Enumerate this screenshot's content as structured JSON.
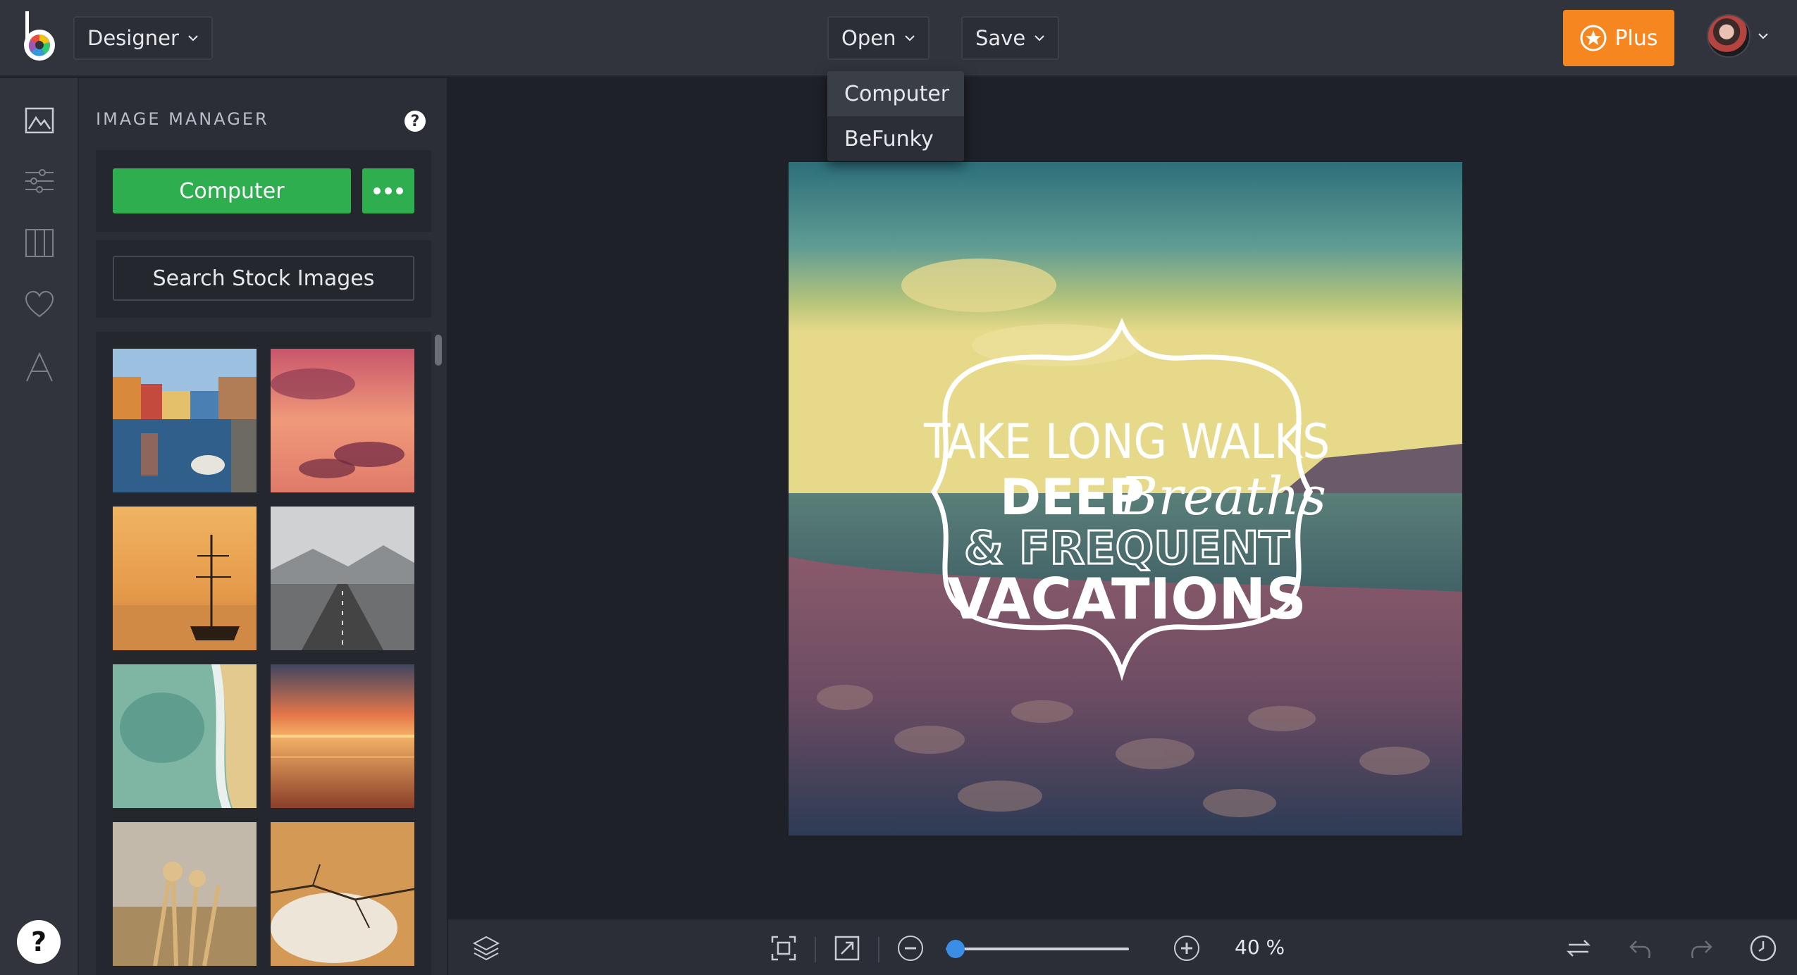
{
  "header": {
    "mode_label": "Designer",
    "open_label": "Open",
    "save_label": "Save",
    "plus_label": "Plus"
  },
  "open_menu": {
    "items": [
      {
        "label": "Computer",
        "active": true
      },
      {
        "label": "BeFunky",
        "active": false
      }
    ]
  },
  "sidebar_rail": {
    "items": [
      "image-manager-icon",
      "adjust-sliders-icon",
      "layouts-icon",
      "favorites-heart-icon",
      "text-icon"
    ],
    "help_label": "?"
  },
  "panel": {
    "title": "IMAGE MANAGER",
    "help_label": "?",
    "computer_label": "Computer",
    "stock_label": "Search Stock Images",
    "thumbnails": [
      "venice-canal",
      "pink-clouds",
      "ship-sunset",
      "road-mountains",
      "aerial-beach",
      "sunset-sea",
      "dry-grass",
      "cracked-ice"
    ]
  },
  "canvas": {
    "quote_lines": [
      "TAKE LONG WALKS",
      "DEEP",
      "Breaths",
      "& FREQUENT",
      "VACATIONS"
    ]
  },
  "bottombar": {
    "zoom_percent": 40,
    "zoom_label": "40 %"
  },
  "colors": {
    "accent_green": "#2fae4f",
    "plus_orange": "#f6861f",
    "zoom_blue": "#3a8ee6"
  }
}
